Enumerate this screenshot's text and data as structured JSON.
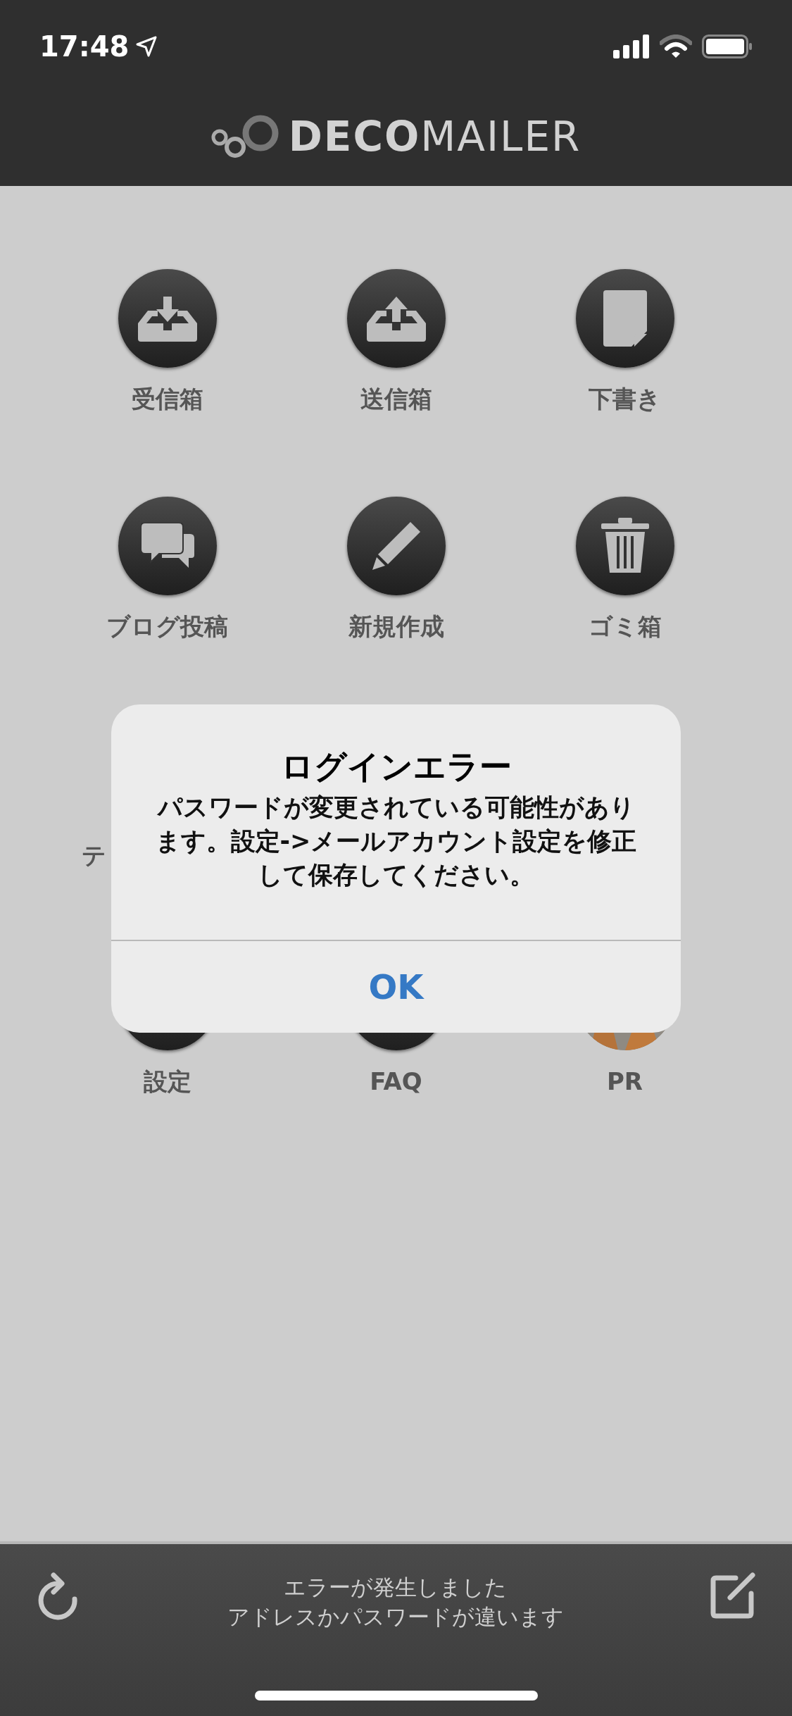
{
  "status_bar": {
    "time": "17:48"
  },
  "header": {
    "logo_bold": "DECO",
    "logo_light": "MAILER"
  },
  "menu_rows": [
    [
      {
        "label": "受信箱",
        "kind": "inbox"
      },
      {
        "label": "送信箱",
        "kind": "outbox"
      },
      {
        "label": "下書き",
        "kind": "draft"
      }
    ],
    [
      {
        "label": "ブログ投稿",
        "kind": "blog"
      },
      {
        "label": "新規作成",
        "kind": "compose"
      },
      {
        "label": "ゴミ箱",
        "kind": "trash"
      }
    ],
    [
      {
        "label": "テ",
        "kind": "hidden"
      }
    ],
    [
      {
        "label": "設定",
        "kind": "plain"
      },
      {
        "label": "FAQ",
        "kind": "plain"
      },
      {
        "label": "PR",
        "kind": "picture"
      }
    ]
  ],
  "alert": {
    "title": "ログインエラー",
    "message": "パスワードが変更されている可能性があります。設定->メールアカウント設定を修正して保存してください。",
    "button": "OK"
  },
  "bottom_bar": {
    "status_lines": [
      "エラーが発生しました",
      "アドレスかパスワードが違います"
    ]
  }
}
